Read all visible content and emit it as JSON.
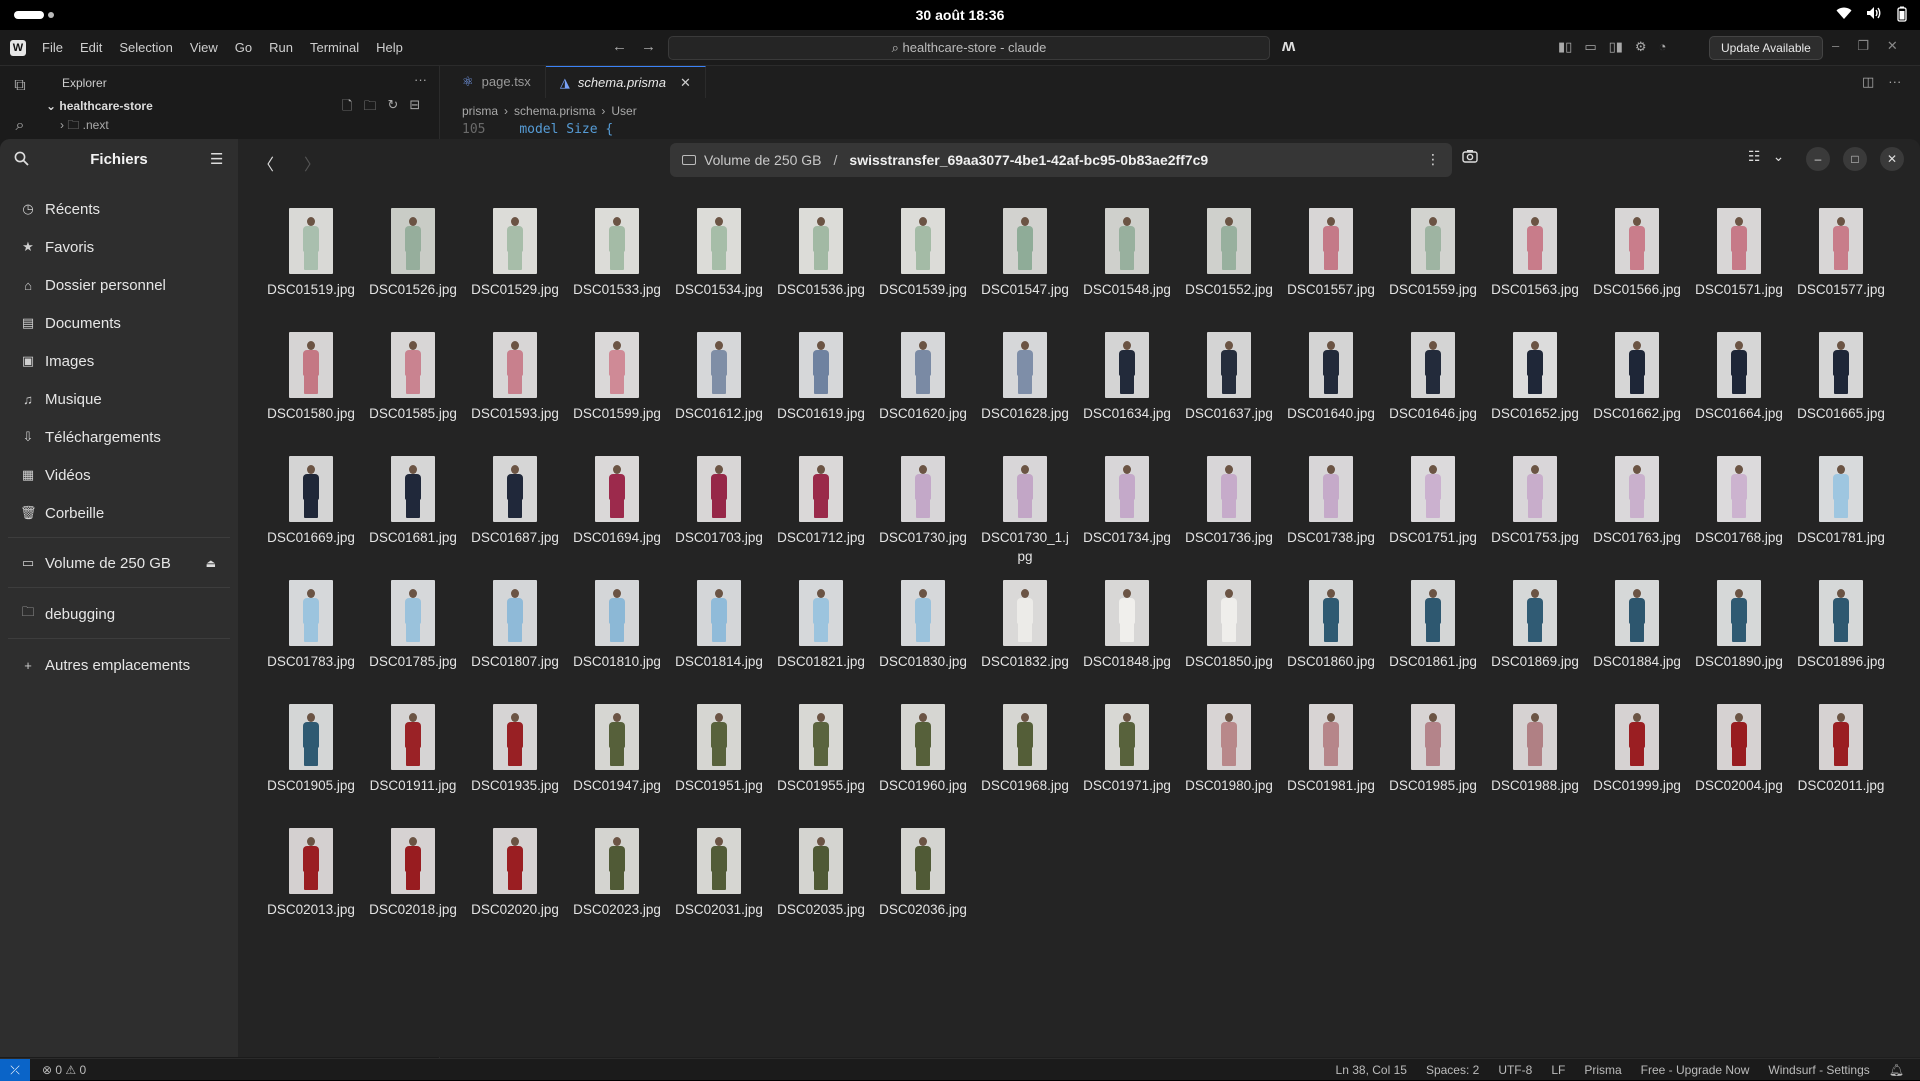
{
  "topbar": {
    "clock": "30 août  18:36"
  },
  "editor": {
    "menu": [
      "File",
      "Edit",
      "Selection",
      "View",
      "Go",
      "Run",
      "Terminal",
      "Help"
    ],
    "search_text": "healthcare-store - claude",
    "update_label": "Update Available",
    "explorer_title": "Explorer",
    "project_name": "healthcare-store",
    "folder_name": ".next",
    "tabs": [
      {
        "label": "page.tsx",
        "active": false
      },
      {
        "label": "schema.prisma",
        "active": true
      }
    ],
    "breadcrumb": [
      "prisma",
      "schema.prisma",
      "User"
    ],
    "code_line_number": "105",
    "code_keyword": "model",
    "code_text": "Size {",
    "status": {
      "problems": "⊗ 0 ⚠ 0",
      "position": "Ln 38, Col 15",
      "spaces": "Spaces: 2",
      "encoding": "UTF-8",
      "eol": "LF",
      "language": "Prisma",
      "plan": "Free - Upgrade Now",
      "settings": "Windsurf - Settings"
    }
  },
  "files_app": {
    "title": "Fichiers",
    "sidebar": {
      "items": [
        {
          "label": "Récents",
          "icon": "clock-icon"
        },
        {
          "label": "Favoris",
          "icon": "star-icon"
        },
        {
          "label": "Dossier personnel",
          "icon": "home-icon"
        },
        {
          "label": "Documents",
          "icon": "document-icon"
        },
        {
          "label": "Images",
          "icon": "image-icon"
        },
        {
          "label": "Musique",
          "icon": "music-icon"
        },
        {
          "label": "Téléchargements",
          "icon": "download-icon"
        },
        {
          "label": "Vidéos",
          "icon": "video-icon"
        },
        {
          "label": "Corbeille",
          "icon": "trash-icon"
        }
      ],
      "volume": "Volume de 250 GB",
      "bookmark": "debugging",
      "other_locations": "Autres emplacements"
    },
    "path": {
      "volume": "Volume de 250 GB",
      "separator": "/",
      "folder": "swisstransfer_69aa3077-4be1-42af-bc95-0b83ae2ff7c9"
    },
    "files": [
      {
        "name": "DSC01519.jpg",
        "bg": "#d9d9d6",
        "top": "#a9bfae",
        "bottom": "#a9bfae"
      },
      {
        "name": "DSC01526.jpg",
        "bg": "#c9ccc6",
        "top": "#96ae9c",
        "bottom": "#96ae9c"
      },
      {
        "name": "DSC01529.jpg",
        "bg": "#dcdcd8",
        "top": "#a7bda9",
        "bottom": "#a7bda9"
      },
      {
        "name": "DSC01533.jpg",
        "bg": "#dcdcd8",
        "top": "#a4bba6",
        "bottom": "#a4bba6"
      },
      {
        "name": "DSC01534.jpg",
        "bg": "#dcdcd8",
        "top": "#a6bda8",
        "bottom": "#a6bda8"
      },
      {
        "name": "DSC01536.jpg",
        "bg": "#dcdcd8",
        "top": "#a2b9a4",
        "bottom": "#a2b9a4"
      },
      {
        "name": "DSC01539.jpg",
        "bg": "#dcdcd8",
        "top": "#a4bba6",
        "bottom": "#a4bba6"
      },
      {
        "name": "DSC01547.jpg",
        "bg": "#d2d2cf",
        "top": "#8fac98",
        "bottom": "#8fac98"
      },
      {
        "name": "DSC01548.jpg",
        "bg": "#cfd0cc",
        "top": "#98b09e",
        "bottom": "#98b09e"
      },
      {
        "name": "DSC01552.jpg",
        "bg": "#cfd0cc",
        "top": "#98b09e",
        "bottom": "#98b09e"
      },
      {
        "name": "DSC01557.jpg",
        "bg": "#d8d6d6",
        "top": "#c47a88",
        "bottom": "#c47a88"
      },
      {
        "name": "DSC01559.jpg",
        "bg": "#d2d3cf",
        "top": "#9eb4a2",
        "bottom": "#9eb4a2"
      },
      {
        "name": "DSC01563.jpg",
        "bg": "#d8d6d6",
        "top": "#c87c8a",
        "bottom": "#c87c8a"
      },
      {
        "name": "DSC01566.jpg",
        "bg": "#d8d6d6",
        "top": "#c97d8b",
        "bottom": "#c97d8b"
      },
      {
        "name": "DSC01571.jpg",
        "bg": "#d8d6d6",
        "top": "#c67a88",
        "bottom": "#c67a88"
      },
      {
        "name": "DSC01577.jpg",
        "bg": "#d8d6d6",
        "top": "#c87d8a",
        "bottom": "#c87d8a"
      },
      {
        "name": "DSC01580.jpg",
        "bg": "#d6d4d4",
        "top": "#c47884",
        "bottom": "#c47884"
      },
      {
        "name": "DSC01585.jpg",
        "bg": "#d8d6d6",
        "top": "#c98390",
        "bottom": "#c98390"
      },
      {
        "name": "DSC01593.jpg",
        "bg": "#d8d6d6",
        "top": "#c8808d",
        "bottom": "#c8808d"
      },
      {
        "name": "DSC01599.jpg",
        "bg": "#dad8d8",
        "top": "#cf8a96",
        "bottom": "#cf8a96"
      },
      {
        "name": "DSC01612.jpg",
        "bg": "#d6d7d9",
        "top": "#7f8ea6",
        "bottom": "#7f8ea6"
      },
      {
        "name": "DSC01619.jpg",
        "bg": "#d6d7d9",
        "top": "#6f82a0",
        "bottom": "#6f82a0"
      },
      {
        "name": "DSC01620.jpg",
        "bg": "#d6d7d9",
        "top": "#7a8aa4",
        "bottom": "#7a8aa4"
      },
      {
        "name": "DSC01628.jpg",
        "bg": "#d6d7d9",
        "top": "#7e8ea8",
        "bottom": "#7e8ea8"
      },
      {
        "name": "DSC01634.jpg",
        "bg": "#d4d4d4",
        "top": "#222a3a",
        "bottom": "#222a3a"
      },
      {
        "name": "DSC01637.jpg",
        "bg": "#d4d4d4",
        "top": "#252d3c",
        "bottom": "#252d3c"
      },
      {
        "name": "DSC01640.jpg",
        "bg": "#d4d4d4",
        "top": "#222a3a",
        "bottom": "#222a3a"
      },
      {
        "name": "DSC01646.jpg",
        "bg": "#d4d4d4",
        "top": "#232b3b",
        "bottom": "#232b3b"
      },
      {
        "name": "DSC01652.jpg",
        "bg": "#dcdcdc",
        "top": "#1f2738",
        "bottom": "#1f2738"
      },
      {
        "name": "DSC01662.jpg",
        "bg": "#d6d6d6",
        "top": "#1e2637",
        "bottom": "#1e2637"
      },
      {
        "name": "DSC01664.jpg",
        "bg": "#d6d6d6",
        "top": "#1e2637",
        "bottom": "#1e2637"
      },
      {
        "name": "DSC01665.jpg",
        "bg": "#d6d6d6",
        "top": "#1e2637",
        "bottom": "#1e2637"
      },
      {
        "name": "DSC01669.jpg",
        "bg": "#d4d4d4",
        "top": "#1f2738",
        "bottom": "#1f2738"
      },
      {
        "name": "DSC01681.jpg",
        "bg": "#d6d6d6",
        "top": "#20283a",
        "bottom": "#20283a"
      },
      {
        "name": "DSC01687.jpg",
        "bg": "#d6d6d6",
        "top": "#20283a",
        "bottom": "#20283a"
      },
      {
        "name": "DSC01694.jpg",
        "bg": "#dad8d8",
        "top": "#9c2a4c",
        "bottom": "#9c2a4c"
      },
      {
        "name": "DSC01703.jpg",
        "bg": "#d8d6d6",
        "top": "#962748",
        "bottom": "#962748"
      },
      {
        "name": "DSC01712.jpg",
        "bg": "#dad8d8",
        "top": "#9a2a4a",
        "bottom": "#9a2a4a"
      },
      {
        "name": "DSC01730.jpg",
        "bg": "#d8d6d8",
        "top": "#c3a8c8",
        "bottom": "#c3a8c8"
      },
      {
        "name": "DSC01730_1.jpg",
        "bg": "#d8d6d8",
        "top": "#c2a6c6",
        "bottom": "#c2a6c6"
      },
      {
        "name": "DSC01734.jpg",
        "bg": "#d8d6d8",
        "top": "#c4a9c9",
        "bottom": "#c4a9c9"
      },
      {
        "name": "DSC01736.jpg",
        "bg": "#d8d6d8",
        "top": "#c6abca",
        "bottom": "#c6abca"
      },
      {
        "name": "DSC01738.jpg",
        "bg": "#d8d6d8",
        "top": "#c5aac9",
        "bottom": "#c5aac9"
      },
      {
        "name": "DSC01751.jpg",
        "bg": "#dcdadc",
        "top": "#cbb1cf",
        "bottom": "#cbb1cf"
      },
      {
        "name": "DSC01753.jpg",
        "bg": "#d9d6d9",
        "top": "#c8adcb",
        "bottom": "#c8adcb"
      },
      {
        "name": "DSC01763.jpg",
        "bg": "#dad8da",
        "top": "#c9b0cc",
        "bottom": "#c9b0cc"
      },
      {
        "name": "DSC01768.jpg",
        "bg": "#dcdadc",
        "top": "#ccb3cf",
        "bottom": "#ccb3cf"
      },
      {
        "name": "DSC01781.jpg",
        "bg": "#d8dadc",
        "top": "#9ec6e0",
        "bottom": "#9ec6e0"
      },
      {
        "name": "DSC01783.jpg",
        "bg": "#d6d8da",
        "top": "#9cc4de",
        "bottom": "#9cc4de"
      },
      {
        "name": "DSC01785.jpg",
        "bg": "#d6d8da",
        "top": "#9ac2dc",
        "bottom": "#9ac2dc"
      },
      {
        "name": "DSC01807.jpg",
        "bg": "#d4d6d8",
        "top": "#8fbad8",
        "bottom": "#8fbad8"
      },
      {
        "name": "DSC01810.jpg",
        "bg": "#d4d6d8",
        "top": "#8cb8d6",
        "bottom": "#8cb8d6"
      },
      {
        "name": "DSC01814.jpg",
        "bg": "#d4d6d8",
        "top": "#90bbd9",
        "bottom": "#90bbd9"
      },
      {
        "name": "DSC01821.jpg",
        "bg": "#d6d8da",
        "top": "#9cc4de",
        "bottom": "#9cc4de"
      },
      {
        "name": "DSC01830.jpg",
        "bg": "#d6d8da",
        "top": "#9ac2dc",
        "bottom": "#9ac2dc"
      },
      {
        "name": "DSC01832.jpg",
        "bg": "#dad9d8",
        "top": "#ecebe8",
        "bottom": "#ecebe8"
      },
      {
        "name": "DSC01848.jpg",
        "bg": "#d8d7d6",
        "top": "#f0efec",
        "bottom": "#f0efec"
      },
      {
        "name": "DSC01850.jpg",
        "bg": "#d8d7d6",
        "top": "#efeeeb",
        "bottom": "#efeeeb"
      },
      {
        "name": "DSC01860.jpg",
        "bg": "#d4d6d6",
        "top": "#2f5a72",
        "bottom": "#2f5a72"
      },
      {
        "name": "DSC01861.jpg",
        "bg": "#d4d6d6",
        "top": "#2e5870",
        "bottom": "#2e5870"
      },
      {
        "name": "DSC01869.jpg",
        "bg": "#d6d8d8",
        "top": "#305b74",
        "bottom": "#305b74"
      },
      {
        "name": "DSC01884.jpg",
        "bg": "#d6d8d8",
        "top": "#2d566e",
        "bottom": "#2d566e"
      },
      {
        "name": "DSC01890.jpg",
        "bg": "#d6d8d8",
        "top": "#2f5a72",
        "bottom": "#2f5a72"
      },
      {
        "name": "DSC01896.jpg",
        "bg": "#d6d8d8",
        "top": "#2e5870",
        "bottom": "#2e5870"
      },
      {
        "name": "DSC01905.jpg",
        "bg": "#d4d6d6",
        "top": "#2f5a72",
        "bottom": "#2f5a72"
      },
      {
        "name": "DSC01911.jpg",
        "bg": "#d6d4d4",
        "top": "#9a2226",
        "bottom": "#9a2226"
      },
      {
        "name": "DSC01935.jpg",
        "bg": "#d6d4d4",
        "top": "#982024",
        "bottom": "#982024"
      },
      {
        "name": "DSC01947.jpg",
        "bg": "#d6d6d2",
        "top": "#56603a",
        "bottom": "#56603a"
      },
      {
        "name": "DSC01951.jpg",
        "bg": "#d6d6d2",
        "top": "#58623c",
        "bottom": "#58623c"
      },
      {
        "name": "DSC01955.jpg",
        "bg": "#d8d8d4",
        "top": "#5a643e",
        "bottom": "#5a643e"
      },
      {
        "name": "DSC01960.jpg",
        "bg": "#d6d6d2",
        "top": "#56603a",
        "bottom": "#56603a"
      },
      {
        "name": "DSC01968.jpg",
        "bg": "#d6d6d2",
        "top": "#545e38",
        "bottom": "#545e38"
      },
      {
        "name": "DSC01971.jpg",
        "bg": "#d8d8d4",
        "top": "#58623c",
        "bottom": "#58623c"
      },
      {
        "name": "DSC01980.jpg",
        "bg": "#d8d4d4",
        "top": "#b8888a",
        "bottom": "#b8888a"
      },
      {
        "name": "DSC01981.jpg",
        "bg": "#d8d4d4",
        "top": "#b6868a",
        "bottom": "#b6868a"
      },
      {
        "name": "DSC01985.jpg",
        "bg": "#d8d4d4",
        "top": "#b4848a",
        "bottom": "#b4848a"
      },
      {
        "name": "DSC01988.jpg",
        "bg": "#d6d2d2",
        "top": "#b08084",
        "bottom": "#b08084"
      },
      {
        "name": "DSC01999.jpg",
        "bg": "#d6d2d2",
        "top": "#9a1e22",
        "bottom": "#9a1e22"
      },
      {
        "name": "DSC02004.jpg",
        "bg": "#d6d2d2",
        "top": "#981c20",
        "bottom": "#981c20"
      },
      {
        "name": "DSC02011.jpg",
        "bg": "#d6d2d2",
        "top": "#9a1e22",
        "bottom": "#9a1e22"
      },
      {
        "name": "DSC02013.jpg",
        "bg": "#d4d0d0",
        "top": "#9a1e22",
        "bottom": "#9a1e22"
      },
      {
        "name": "DSC02018.jpg",
        "bg": "#d6d2d2",
        "top": "#981c20",
        "bottom": "#981c20"
      },
      {
        "name": "DSC02020.jpg",
        "bg": "#d6d2d2",
        "top": "#9a1e22",
        "bottom": "#9a1e22"
      },
      {
        "name": "DSC02023.jpg",
        "bg": "#d4d4d0",
        "top": "#505a36",
        "bottom": "#505a36"
      },
      {
        "name": "DSC02031.jpg",
        "bg": "#d6d6d2",
        "top": "#525c38",
        "bottom": "#525c38"
      },
      {
        "name": "DSC02035.jpg",
        "bg": "#d4d4d0",
        "top": "#4f5935",
        "bottom": "#4f5935"
      },
      {
        "name": "DSC02036.jpg",
        "bg": "#d4d4d0",
        "top": "#505a36",
        "bottom": "#505a36"
      }
    ]
  }
}
